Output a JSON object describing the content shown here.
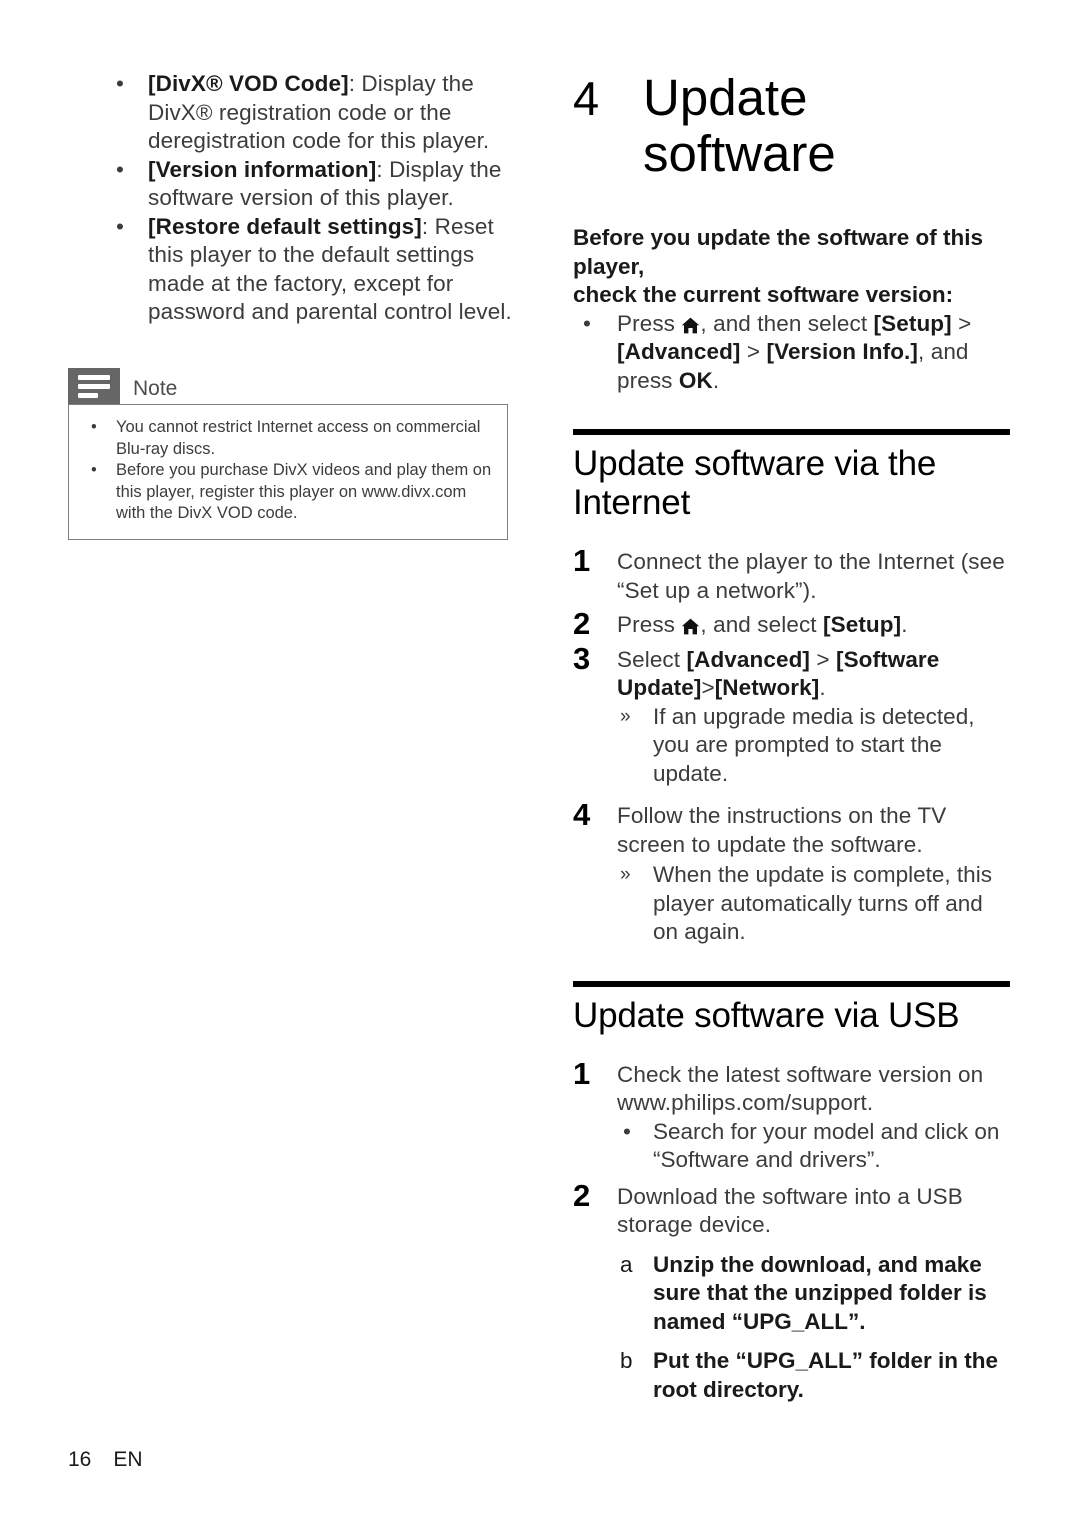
{
  "page": {
    "number": "16",
    "language": "EN"
  },
  "left_column": {
    "bullets": [
      {
        "bold": "[DivX® VOD Code]",
        "rest": ": Display the DivX® registration code or the deregistration code for this player."
      },
      {
        "bold": "[Version information]",
        "rest": ": Display the software version of this player."
      },
      {
        "bold": "[Restore default settings]",
        "rest": ": Reset this player to the default settings made at the factory, except for password and parental control level."
      }
    ],
    "note": {
      "title": "Note",
      "icon": "note-lines-icon",
      "items": [
        "You cannot restrict Internet access on commercial Blu-ray discs.",
        "Before you purchase DivX videos and play them on this player, register this player on www.divx.com with the DivX VOD code."
      ]
    }
  },
  "right_column": {
    "chapter": {
      "number": "4",
      "title": "Update software"
    },
    "intro": {
      "line1": "Before you update the software of this player,",
      "line2": "check the current software version:",
      "bullet": {
        "pre": "Press ",
        "icon": "home-icon",
        "mid": ", and then select ",
        "bold1": "[Setup]",
        "sep1": " > ",
        "bold2": "[Advanced]",
        "sep2": " > ",
        "bold3": "[Version Info.]",
        "post": ", and press ",
        "bold4": "OK",
        "end": "."
      }
    },
    "sections": [
      {
        "heading": "Update software via the Internet",
        "steps": [
          {
            "num": "1",
            "text": "Connect the player to the Internet (see “Set up a network”)."
          },
          {
            "num": "2",
            "pre": "Press ",
            "icon": "home-icon",
            "mid": ", and select ",
            "bold": "[Setup]",
            "post": "."
          },
          {
            "num": "3",
            "pre": "Select ",
            "bold1": "[Advanced]",
            "sep1": " > ",
            "bold2": "[Software Update]",
            "sep2": ">",
            "bold3": "[Network]",
            "post": ".",
            "subs": [
              "If an upgrade media is detected, you are prompted to start the update."
            ]
          },
          {
            "num": "4",
            "text": "Follow the instructions on the TV screen to update the software.",
            "subs": [
              "When the update is complete, this player automatically turns off and on again."
            ]
          }
        ]
      },
      {
        "heading": "Update software via USB",
        "steps": [
          {
            "num": "1",
            "text": "Check the latest software version on www.philips.com/support.",
            "dot_subs": [
              "Search for your model and click on “Software and drivers”."
            ]
          },
          {
            "num": "2",
            "text": "Download the software into a USB storage device.",
            "alpha_subs": [
              {
                "marker": "a",
                "pre": "Unzip the download, and make sure that the unzipped folder is named ",
                "bold": "“UPG_ALL”",
                "post": "."
              },
              {
                "marker": "b",
                "pre": "Put the ",
                "bold": "“UPG_ALL”",
                "post": " folder in the root directory."
              }
            ]
          }
        ]
      }
    ]
  }
}
